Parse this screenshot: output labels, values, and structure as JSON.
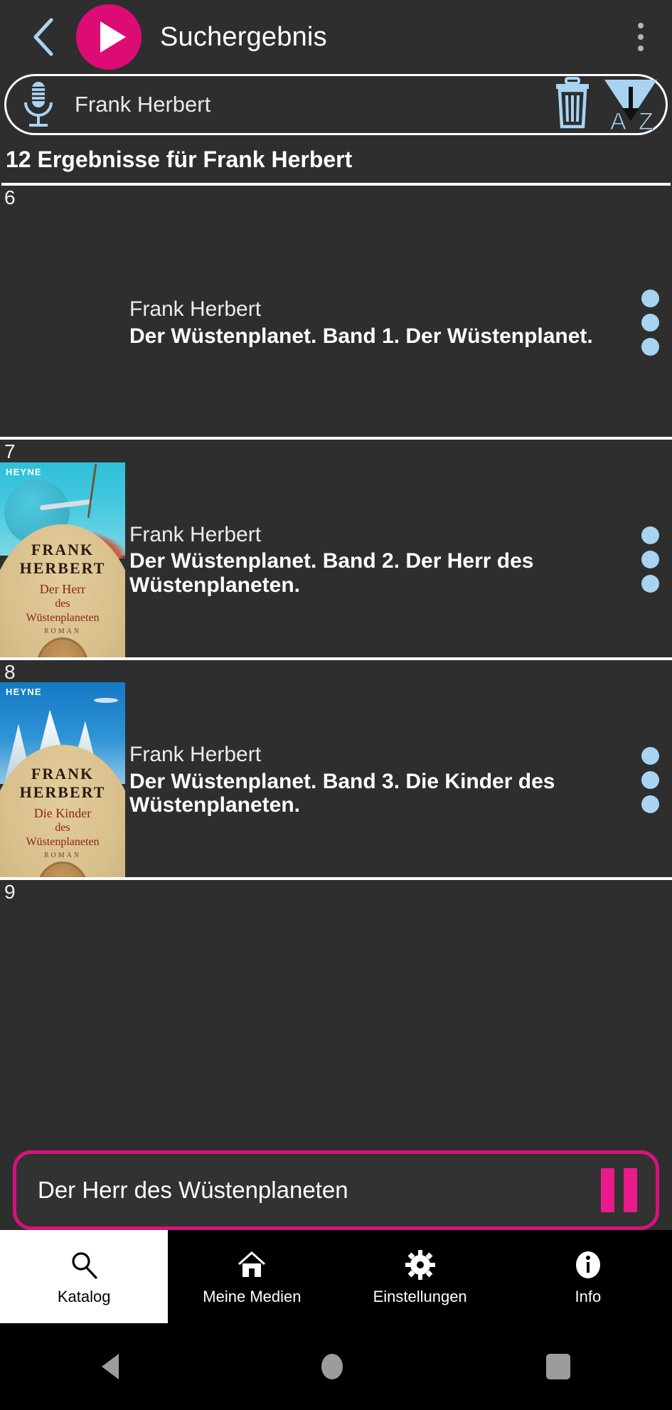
{
  "appbar": {
    "back_icon": "chevron-left-icon",
    "play_icon": "play-icon",
    "title": "Suchergebnis",
    "overflow_icon": "more-vertical-icon"
  },
  "search": {
    "mic_icon": "microphone-icon",
    "value": "Frank Herbert",
    "placeholder": "Frank Herbert",
    "clear_icon": "trash-icon",
    "sort_icon": "sort-az-icon",
    "sort_label_a": "A",
    "sort_label_z": "Z"
  },
  "results": {
    "heading": "12 Ergebnisse für Frank Herbert",
    "items": [
      {
        "index": "6",
        "author": "Frank Herbert",
        "title": "Der Wüstenplanet. Band 1. Der Wüstenplanet.",
        "has_cover": false,
        "cover": {
          "publisher": "",
          "author_line1": "",
          "author_line2": "",
          "title_line1": "",
          "title_line2": "",
          "title_line3": "",
          "subtitle": ""
        },
        "menu_icon": "more-vertical-icon"
      },
      {
        "index": "7",
        "author": "Frank Herbert",
        "title": "Der Wüstenplanet. Band 2. Der Herr des Wüstenplaneten.",
        "has_cover": true,
        "cover": {
          "publisher": "HEYNE",
          "author_line1": "FRANK",
          "author_line2": "HERBERT",
          "title_line1": "Der Herr",
          "title_line2": "des",
          "title_line3": "Wüstenplaneten",
          "subtitle": "ROMAN"
        },
        "menu_icon": "more-vertical-icon"
      },
      {
        "index": "8",
        "author": "Frank Herbert",
        "title": "Der Wüstenplanet. Band 3. Die Kinder des Wüstenplaneten.",
        "has_cover": true,
        "cover": {
          "publisher": "HEYNE",
          "author_line1": "FRANK",
          "author_line2": "HERBERT",
          "title_line1": "Die Kinder",
          "title_line2": "des",
          "title_line3": "Wüstenplaneten",
          "subtitle": "ROMAN"
        },
        "menu_icon": "more-vertical-icon"
      },
      {
        "index": "9",
        "author": "",
        "title": "",
        "has_cover": false,
        "cover": {
          "publisher": "",
          "author_line1": "",
          "author_line2": "",
          "title_line1": "",
          "title_line2": "",
          "title_line3": "",
          "subtitle": ""
        },
        "menu_icon": "more-vertical-icon"
      }
    ]
  },
  "now_playing": {
    "title": "Der Herr des Wüstenplaneten",
    "pause_icon": "pause-icon"
  },
  "bottom_nav": [
    {
      "label": "Katalog",
      "icon": "search-icon",
      "active": true
    },
    {
      "label": "Meine Medien",
      "icon": "home-icon",
      "active": false
    },
    {
      "label": "Einstellungen",
      "icon": "gear-icon",
      "active": false
    },
    {
      "label": "Info",
      "icon": "info-icon",
      "active": false
    }
  ],
  "system_nav": {
    "back": "android-back-icon",
    "home": "android-home-icon",
    "recents": "android-recents-icon"
  },
  "colors": {
    "accent_pink": "#dd0b74",
    "player_pink": "#d8127d",
    "icon_blue": "#a8d4f2",
    "background": "#2e2e2e"
  }
}
